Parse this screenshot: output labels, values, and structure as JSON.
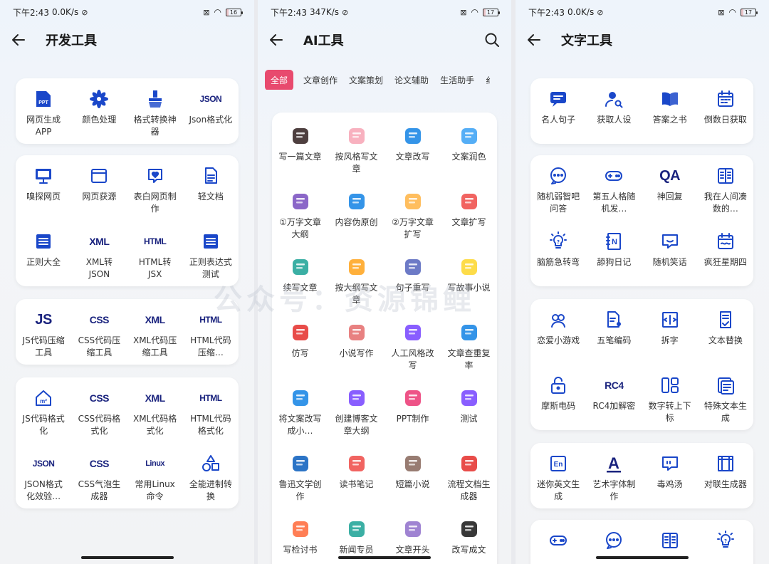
{
  "status": [
    {
      "time": "下午2:43",
      "net": "0.0K/s",
      "battery": "16"
    },
    {
      "time": "下午2:43",
      "net": "347K/s",
      "battery": "17"
    },
    {
      "time": "下午2:43",
      "net": "0.0K/s",
      "battery": "17"
    }
  ],
  "dev": {
    "title": "开发工具",
    "cards": [
      [
        {
          "label": "网页生成APP",
          "icon": "ppt-icon"
        },
        {
          "label": "颜色处理",
          "icon": "color-icon"
        },
        {
          "label": "格式转换神器",
          "icon": "brush-icon"
        },
        {
          "label": "Json格式化",
          "icon": "json-icon",
          "text": "JSON"
        }
      ],
      [
        {
          "label": "嗅探网页",
          "icon": "monitor-icon"
        },
        {
          "label": "网页获源",
          "icon": "window-icon"
        },
        {
          "label": "表白网页制作",
          "icon": "heart-chat-icon"
        },
        {
          "label": "轻文档",
          "icon": "doc-icon"
        },
        {
          "label": "正则大全",
          "icon": "list-icon"
        },
        {
          "label": "XML转JSON",
          "icon": "xml-icon",
          "text": "XML"
        },
        {
          "label": "HTML转JSX",
          "icon": "html-icon",
          "text": "HTML"
        },
        {
          "label": "正则表达式测试",
          "icon": "list-icon"
        }
      ],
      [
        {
          "label": "JS代码压缩工具",
          "icon": "js-icon",
          "text": "JS"
        },
        {
          "label": "CSS代码压缩工具",
          "icon": "css-icon",
          "text": "CSS"
        },
        {
          "label": "XML代码压缩工具",
          "icon": "xml-icon",
          "text": "XML"
        },
        {
          "label": "HTML代码压缩…",
          "icon": "html-icon",
          "text": "HTML"
        }
      ],
      [
        {
          "label": "JS代码格式化",
          "icon": "home-m2-icon"
        },
        {
          "label": "CSS代码格式化",
          "icon": "css-icon",
          "text": "CSS"
        },
        {
          "label": "XML代码格式化",
          "icon": "xml-icon",
          "text": "XML"
        },
        {
          "label": "HTML代码格式化",
          "icon": "html-icon",
          "text": "HTML"
        },
        {
          "label": "JSON格式化效验…",
          "icon": "json-icon",
          "text": "JSON"
        },
        {
          "label": "CSS气泡生成器",
          "icon": "css-icon",
          "text": "CSS"
        },
        {
          "label": "常用Linux命令",
          "icon": "linux-icon",
          "text": "Linux"
        },
        {
          "label": "全能进制转换",
          "icon": "shapes-icon"
        }
      ]
    ]
  },
  "ai": {
    "title": "AI工具",
    "tabs": [
      "全部",
      "文章创作",
      "文案策划",
      "论文辅助",
      "生活助手",
      "纟"
    ],
    "items": [
      {
        "label": "写一篇文章",
        "icon": "write-article-icon",
        "color": "#3b2a2a"
      },
      {
        "label": "按风格写文章",
        "icon": "style-write-icon",
        "color": "#f7a8b8"
      },
      {
        "label": "文章改写",
        "icon": "rewrite-icon",
        "color": "#1e88e5"
      },
      {
        "label": "文案润色",
        "icon": "polish-icon",
        "color": "#42a5f5"
      },
      {
        "label": "①万字文章大纲",
        "icon": "outline-icon",
        "color": "#7e57c2"
      },
      {
        "label": "内容伪原创",
        "icon": "code-icon",
        "color": "#1e88e5"
      },
      {
        "label": "②万字文章扩写",
        "icon": "expand-icon",
        "color": "#ffb74d"
      },
      {
        "label": "文章扩写",
        "icon": "cube-icon",
        "color": "#ef5350"
      },
      {
        "label": "续写文章",
        "icon": "continue-icon",
        "color": "#26a69a"
      },
      {
        "label": "按大纲写文章",
        "icon": "outline-write-icon",
        "color": "#ffa726"
      },
      {
        "label": "句子重写",
        "icon": "pen-icon",
        "color": "#5c6bc0"
      },
      {
        "label": "写故事小说",
        "icon": "story-icon",
        "color": "#fdd835"
      },
      {
        "label": "仿写",
        "icon": "imitate-icon",
        "color": "#e53935"
      },
      {
        "label": "小说写作",
        "icon": "novel-icon",
        "color": "#e57373"
      },
      {
        "label": "人工风格改写",
        "icon": "human-style-icon",
        "color": "#7c4dff"
      },
      {
        "label": "文章查重复率",
        "icon": "check-icon",
        "color": "#1e88e5"
      },
      {
        "label": "将文案改写成小…",
        "icon": "book-blue-icon",
        "color": "#1e88e5"
      },
      {
        "label": "创建博客文章大纲",
        "icon": "blog-icon",
        "color": "#7c4dff"
      },
      {
        "label": "PPT制作",
        "icon": "ppt-make-icon",
        "color": "#ec407a"
      },
      {
        "label": "测试",
        "icon": "test-icon",
        "color": "#7c4dff"
      },
      {
        "label": "鲁迅文学创作",
        "icon": "luxun-icon",
        "color": "#1565c0"
      },
      {
        "label": "读书笔记",
        "icon": "notes-icon",
        "color": "#ef5350"
      },
      {
        "label": "短篇小说",
        "icon": "short-story-icon",
        "color": "#8d6e63"
      },
      {
        "label": "流程文档生成器",
        "icon": "flow-doc-icon",
        "color": "#e53935"
      },
      {
        "label": "写检讨书",
        "icon": "review-icon",
        "color": "#ff7043"
      },
      {
        "label": "新闻专员",
        "icon": "news-icon",
        "color": "#26a69a"
      },
      {
        "label": "文章开头",
        "icon": "opening-icon",
        "color": "#9575cd"
      },
      {
        "label": "改写成文",
        "icon": "gaixie-icon",
        "color": "#222222"
      }
    ]
  },
  "text": {
    "title": "文字工具",
    "cards": [
      [
        {
          "label": "名人句子",
          "icon": "chat-icon"
        },
        {
          "label": "获取人设",
          "icon": "user-search-icon"
        },
        {
          "label": "答案之书",
          "icon": "book-open-icon"
        },
        {
          "label": "倒数日获取",
          "icon": "calendar-icon"
        }
      ],
      [
        {
          "label": "随机弱智吧问答",
          "icon": "dots-bubble-icon"
        },
        {
          "label": "第五人格随机发…",
          "icon": "gamepad-icon"
        },
        {
          "label": "神回复",
          "icon": "qa-icon",
          "text": "QA"
        },
        {
          "label": "我在人间凑数的…",
          "icon": "grid-book-icon"
        },
        {
          "label": "脑筋急转弯",
          "icon": "bulb-icon"
        },
        {
          "label": "舔狗日记",
          "icon": "notebook-icon"
        },
        {
          "label": "随机笑话",
          "icon": "smile-chat-icon"
        },
        {
          "label": "疯狂星期四",
          "icon": "calendar-wave-icon"
        }
      ],
      [
        {
          "label": "恋爱小游戏",
          "icon": "hearts-icon"
        },
        {
          "label": "五笔编码",
          "icon": "doc-people-icon"
        },
        {
          "label": "拆字",
          "icon": "split-icon"
        },
        {
          "label": "文本替换",
          "icon": "replace-icon"
        },
        {
          "label": "摩斯电码",
          "icon": "lock-icon"
        },
        {
          "label": "RC4加解密",
          "icon": "rc4-icon",
          "text": "RC4"
        },
        {
          "label": "数字转上下标",
          "icon": "subscript-icon"
        },
        {
          "label": "特殊文本生成",
          "icon": "special-text-icon"
        }
      ],
      [
        {
          "label": "迷你英文生成",
          "icon": "en-icon"
        },
        {
          "label": "艺术字体制作",
          "icon": "font-a-icon"
        },
        {
          "label": "毒鸡汤",
          "icon": "quote-bubble-icon"
        },
        {
          "label": "对联生成器",
          "icon": "couplet-icon"
        }
      ],
      [
        {
          "label": "",
          "icon": "gamepad-icon"
        },
        {
          "label": "",
          "icon": "dots-bubble-icon"
        },
        {
          "label": "",
          "icon": "grid-book-icon"
        },
        {
          "label": "",
          "icon": "bulb-icon"
        }
      ]
    ]
  },
  "watermark": "公众号：资源锦鲤",
  "colors": {
    "accent": "#e84a6e",
    "icon_blue": "#1a47c9",
    "icon_navy": "#1a237e"
  }
}
